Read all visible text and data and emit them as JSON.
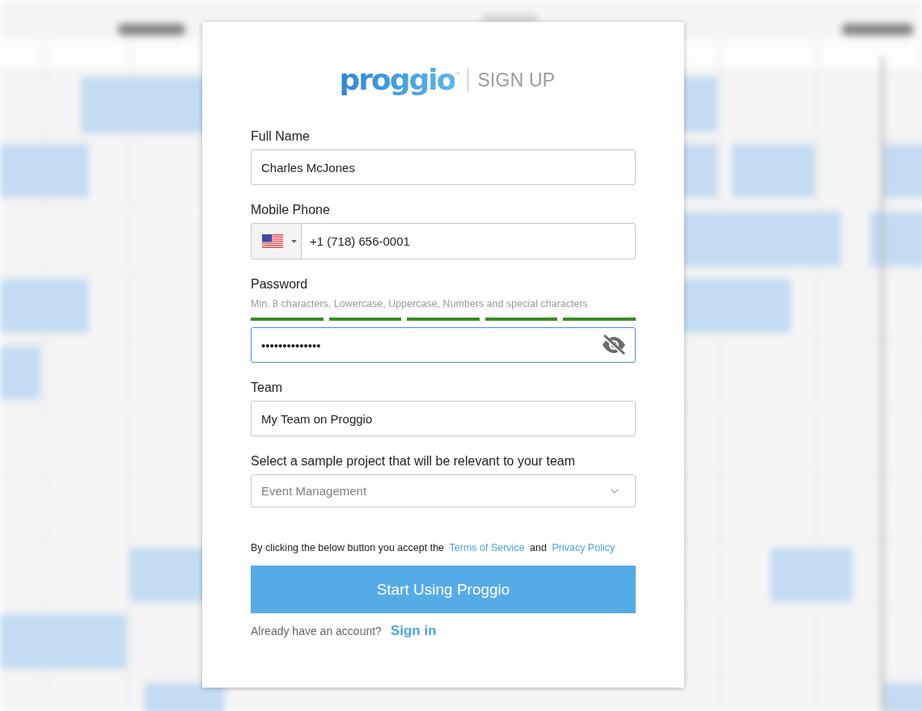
{
  "logo": {
    "wordmark": "proggio",
    "trademark": "™"
  },
  "heading": "SIGN UP",
  "fields": [
    {
      "kind": "text",
      "label": "Full Name",
      "value": "Charles McJones",
      "focused": false
    },
    {
      "kind": "phone",
      "label": "Mobile Phone",
      "value": "+1 (718) 656-0001",
      "focused": false
    },
    {
      "kind": "password",
      "label": "Password",
      "hint": "Min. 8 characters, Lowercase, Uppercase, Numbers and special characters",
      "strength": [
        {
          "on": true
        },
        {
          "on": true
        },
        {
          "on": true
        },
        {
          "on": true
        },
        {
          "on": true
        }
      ],
      "value": "••••••••••••••",
      "focused": true,
      "revealed": false
    },
    {
      "kind": "text",
      "label": "Team",
      "value": "My Team on Proggio",
      "focused": false
    },
    {
      "kind": "select",
      "label": "Select a sample project that will be relevant to your team",
      "value": "Event Management",
      "focused": false
    }
  ],
  "terms": {
    "lead": "By clicking the below button you accept the",
    "terms_link": "Terms of Service",
    "joiner": "and",
    "privacy_link": "Privacy Policy"
  },
  "submit_button": "Start Using Proggio",
  "signin": {
    "prompt": "Already have an account?",
    "link": "Sign in"
  }
}
